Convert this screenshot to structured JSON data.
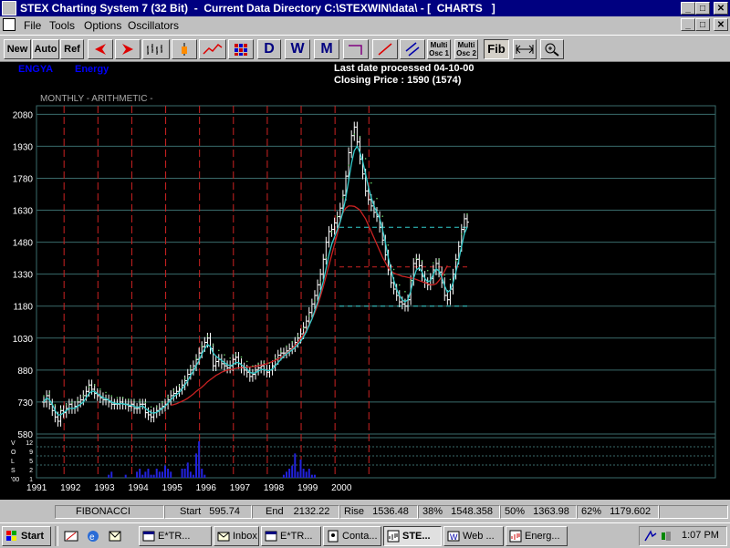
{
  "window": {
    "title": "STEX Charting System 7 (32 Bit)  -  Current Data Directory C:\\STEXWIN\\data\\ - [  CHARTS   ]"
  },
  "menu": [
    "File",
    "Tools",
    "Options",
    "Oscillators"
  ],
  "toolbar": [
    {
      "label": "New",
      "icon": "new"
    },
    {
      "label": "Auto",
      "icon": "auto"
    },
    {
      "label": "Ref",
      "icon": "ref"
    },
    {
      "label": "",
      "icon": "arrow-left-icon"
    },
    {
      "label": "",
      "icon": "arrow-right-icon"
    },
    {
      "label": "",
      "icon": "bar-chart-icon"
    },
    {
      "label": "",
      "icon": "candle-icon"
    },
    {
      "label": "",
      "icon": "line-chart-icon"
    },
    {
      "label": "",
      "icon": "grid-icon"
    },
    {
      "label": "D",
      "icon": "daily"
    },
    {
      "label": "W",
      "icon": "weekly"
    },
    {
      "label": "M",
      "icon": "monthly"
    },
    {
      "label": "",
      "icon": "trendline-bracket-icon"
    },
    {
      "label": "",
      "icon": "trendline-icon"
    },
    {
      "label": "",
      "icon": "channel-icon"
    },
    {
      "label": "Multi Osc 1",
      "icon": "osc1"
    },
    {
      "label": "Multi Osc 2",
      "icon": "osc2"
    },
    {
      "label": "Fib",
      "icon": "fib"
    },
    {
      "label": "",
      "icon": "expand-icon"
    },
    {
      "label": "",
      "icon": "zoom-icon"
    }
  ],
  "chart": {
    "symbol": "ENGYA",
    "name": "Energy",
    "last_date": "Last date processed 04-10-00",
    "closing_price": "Closing Price : 1590  (1574)",
    "mode": "MONTHLY - ARITHMETIC -",
    "volume_labels": [
      "V",
      "O",
      "L",
      "S",
      "'00"
    ],
    "volume_ticks": [
      "12",
      "9",
      "5",
      "2",
      "1"
    ]
  },
  "chart_data": {
    "type": "bar",
    "title": "MONTHLY - ARITHMETIC -",
    "x_labels": [
      "1991",
      "1992",
      "1993",
      "1994",
      "1995",
      "1996",
      "1997",
      "1998",
      "1999",
      "2000"
    ],
    "y_ticks": [
      2080,
      1930,
      1780,
      1630,
      1480,
      1330,
      1180,
      1030,
      880,
      730,
      580
    ],
    "ylim": [
      580,
      2120
    ],
    "close": [
      730,
      760,
      720,
      690,
      660,
      640,
      690,
      680,
      700,
      720,
      700,
      710,
      730,
      740,
      760,
      780,
      810,
      790,
      770,
      760,
      750,
      740,
      740,
      730,
      720,
      720,
      720,
      730,
      720,
      720,
      710,
      720,
      700,
      700,
      720,
      720,
      680,
      670,
      660,
      680,
      690,
      700,
      710,
      720,
      740,
      760,
      770,
      780,
      790,
      810,
      830,
      860,
      880,
      900,
      930,
      960,
      990,
      1010,
      1030,
      980,
      900,
      920,
      930,
      910,
      900,
      890,
      900,
      930,
      940,
      910,
      890,
      880,
      870,
      850,
      860,
      880,
      890,
      900,
      880,
      870,
      880,
      900,
      930,
      950,
      960,
      960,
      970,
      980,
      990,
      1010,
      1030,
      1050,
      1080,
      1110,
      1150,
      1190,
      1230,
      1280,
      1330,
      1400,
      1480,
      1530,
      1540,
      1570,
      1600,
      1640,
      1700,
      1790,
      1900,
      1980,
      2020,
      1950,
      1870,
      1800,
      1720,
      1680,
      1650,
      1620,
      1600,
      1550,
      1490,
      1420,
      1350,
      1290,
      1260,
      1230,
      1200,
      1190,
      1180,
      1210,
      1300,
      1380,
      1400,
      1370,
      1320,
      1290,
      1280,
      1310,
      1350,
      1380,
      1340,
      1290,
      1230,
      1210,
      1260,
      1330,
      1400,
      1460,
      1540,
      1590,
      1574
    ],
    "ma_short": [
      730,
      750,
      740,
      720,
      690,
      670,
      670,
      680,
      690,
      700,
      700,
      700,
      710,
      720,
      730,
      750,
      770,
      780,
      780,
      770,
      760,
      750,
      745,
      740,
      730,
      725,
      722,
      723,
      722,
      720,
      715,
      715,
      710,
      705,
      708,
      712,
      700,
      690,
      680,
      678,
      682,
      690,
      700,
      710,
      725,
      740,
      755,
      765,
      775,
      790,
      810,
      830,
      855,
      875,
      900,
      925,
      955,
      980,
      1000,
      990,
      960,
      945,
      935,
      925,
      915,
      905,
      900,
      905,
      915,
      915,
      905,
      895,
      885,
      870,
      865,
      868,
      875,
      883,
      882,
      878,
      878,
      885,
      900,
      915,
      930,
      945,
      955,
      965,
      975,
      985,
      1000,
      1015,
      1035,
      1060,
      1090,
      1120,
      1160,
      1200,
      1245,
      1295,
      1355,
      1420,
      1470,
      1505,
      1540,
      1575,
      1625,
      1690,
      1770,
      1850,
      1910,
      1930,
      1900,
      1860,
      1800,
      1740,
      1690,
      1650,
      1620,
      1590,
      1540,
      1480,
      1410,
      1350,
      1300,
      1260,
      1230,
      1210,
      1200,
      1210,
      1250,
      1310,
      1350,
      1360,
      1340,
      1310,
      1295,
      1300,
      1330,
      1355,
      1345,
      1315,
      1275,
      1245,
      1255,
      1290,
      1340,
      1395,
      1460,
      1520,
      1550
    ],
    "ma_long": [
      null,
      null,
      null,
      null,
      null,
      null,
      null,
      null,
      null,
      null,
      null,
      null,
      null,
      null,
      null,
      null,
      null,
      null,
      null,
      null,
      null,
      null,
      null,
      null,
      null,
      null,
      null,
      null,
      null,
      null,
      null,
      null,
      null,
      null,
      null,
      null,
      null,
      null,
      null,
      null,
      null,
      null,
      null,
      null,
      null,
      715,
      718,
      722,
      728,
      734,
      740,
      748,
      758,
      768,
      780,
      790,
      800,
      812,
      825,
      835,
      845,
      855,
      862,
      870,
      875,
      880,
      882,
      885,
      888,
      890,
      892,
      893,
      894,
      895,
      896,
      898,
      900,
      903,
      906,
      910,
      915,
      920,
      926,
      932,
      940,
      948,
      958,
      968,
      980,
      994,
      1010,
      1028,
      1046,
      1068,
      1094,
      1120,
      1150,
      1185,
      1225,
      1270,
      1320,
      1370,
      1420,
      1470,
      1520,
      1580,
      1620,
      1640,
      1650,
      1650,
      1648,
      1640,
      1630,
      1610,
      1590,
      1560,
      1530,
      1500,
      1470,
      1440,
      1410,
      1385,
      1360,
      1345,
      1335,
      1330,
      1325,
      1320,
      1318,
      1315,
      1312,
      1310,
      1305,
      1300,
      1295,
      1290,
      1285,
      1280,
      1280,
      1285,
      1300,
      1320,
      1345,
      1370
    ],
    "fib_lines": [
      1550,
      1363.98,
      1180
    ],
    "volume": [
      0,
      0,
      0,
      0,
      0,
      0,
      0,
      0,
      0,
      0,
      0,
      0,
      0,
      0,
      0,
      0,
      0,
      0,
      0,
      0,
      0,
      0,
      0,
      1,
      2,
      0,
      0,
      0,
      0,
      1,
      0,
      0,
      0,
      2,
      3,
      1,
      2,
      3,
      1,
      1,
      3,
      2,
      2,
      4,
      3,
      2,
      0,
      0,
      0,
      3,
      3,
      5,
      2,
      1,
      8,
      12,
      3,
      1,
      0,
      0,
      0,
      0,
      0,
      0,
      0,
      0,
      0,
      0,
      0,
      0,
      0,
      0,
      0,
      0,
      0,
      0,
      0,
      0,
      0,
      0,
      0,
      0,
      0,
      0,
      0,
      1,
      2,
      3,
      4,
      8,
      2,
      6,
      3,
      2,
      3,
      1,
      1,
      0,
      0,
      0,
      0,
      0,
      0,
      0,
      0,
      0,
      0,
      0,
      0,
      0,
      0,
      0,
      0,
      0,
      0,
      0,
      0,
      0,
      0,
      0,
      0,
      0,
      0,
      0,
      0,
      0,
      0,
      0,
      0,
      0,
      0,
      0,
      0,
      0,
      0,
      0,
      0,
      0,
      0,
      0,
      0,
      0,
      0,
      0,
      0,
      0,
      0,
      0,
      0,
      0,
      0
    ]
  },
  "status": {
    "mode": "FIBONACCI",
    "start_label": "Start",
    "start": "595.74",
    "end_label": "End",
    "end": "2132.22",
    "rise_label": "Rise",
    "rise": "1536.48",
    "p38": "38%",
    "v38": "1548.358",
    "p50": "50%",
    "v50": "1363.98",
    "p62": "62%",
    "v62": "1179.602"
  },
  "taskbar": {
    "start_label": "Start",
    "tasks": [
      "E*TR...",
      "Inbox ...",
      "E*TR...",
      "Conta...",
      "STE...",
      "Web ...",
      "Energ..."
    ],
    "clock": "1:07 PM"
  },
  "colors": {
    "title_bar": "#000080",
    "chart_bg": "#000000",
    "grid": "#3a6b6b",
    "year_divider": "#cc2222",
    "price_bars": "#ffffff",
    "ma_short": "#33cccc",
    "ma_long": "#cc2222",
    "volume": "#2222dd"
  }
}
